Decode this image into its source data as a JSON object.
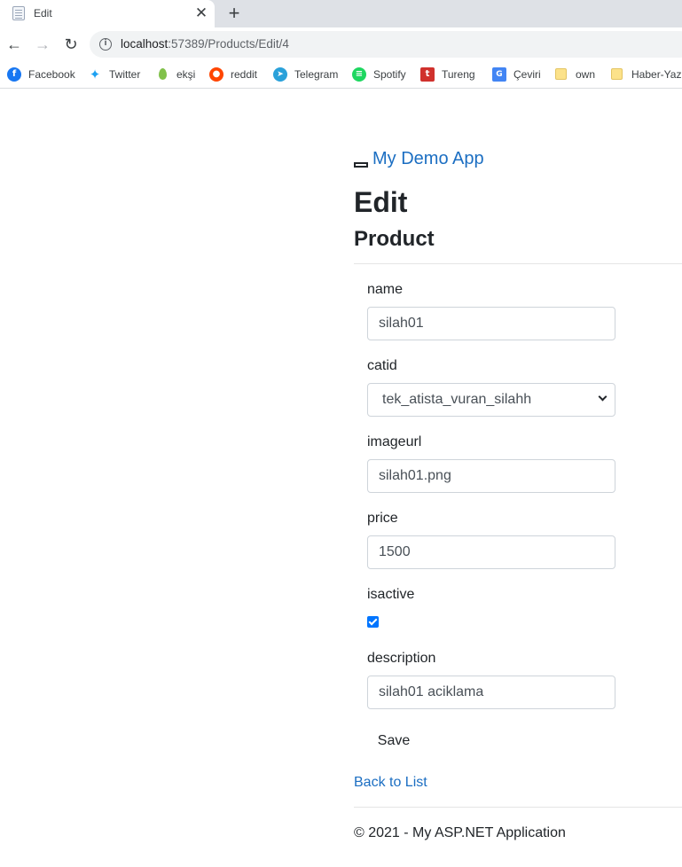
{
  "browser": {
    "tab_title": "Edit",
    "tab_close": "✕",
    "new_tab": "+",
    "url_host": "localhost",
    "url_path": ":57389/Products/Edit/4",
    "nav_back": "←",
    "nav_forward": "→",
    "nav_reload": "↻"
  },
  "bookmarks": [
    {
      "label": "Facebook",
      "icon": "facebook-icon",
      "glyph": "f"
    },
    {
      "label": "Twitter",
      "icon": "twitter-icon",
      "glyph": "🐦"
    },
    {
      "label": "ekşi",
      "icon": "eksi-icon",
      "glyph": ""
    },
    {
      "label": "reddit",
      "icon": "reddit-icon",
      "glyph": "●"
    },
    {
      "label": "Telegram",
      "icon": "telegram-icon",
      "glyph": "➤"
    },
    {
      "label": "Spotify",
      "icon": "spotify-icon",
      "glyph": "≡"
    },
    {
      "label": "Tureng",
      "icon": "tureng-icon",
      "glyph": "t"
    },
    {
      "label": "Çeviri",
      "icon": "translate-icon",
      "glyph": "G"
    },
    {
      "label": "own",
      "icon": "folder-icon",
      "glyph": ""
    },
    {
      "label": "Haber-Yazı",
      "icon": "folder-icon",
      "glyph": ""
    }
  ],
  "app": {
    "brand": "My Demo App"
  },
  "page": {
    "title": "Edit",
    "subtitle": "Product"
  },
  "form": {
    "name_label": "name",
    "name_value": "silah01",
    "catid_label": "catid",
    "catid_value": "tek_atista_vuran_silahh",
    "imageurl_label": "imageurl",
    "imageurl_value": "silah01.png",
    "price_label": "price",
    "price_value": "1500",
    "isactive_label": "isactive",
    "isactive_checked": true,
    "description_label": "description",
    "description_value": "silah01 aciklama",
    "save_label": "Save"
  },
  "links": {
    "back_to_list": "Back to List"
  },
  "footer": {
    "text": "© 2021 - My ASP.NET Application"
  },
  "colors": {
    "link": "#1b6ec2",
    "checkbox": "#0075ff"
  }
}
